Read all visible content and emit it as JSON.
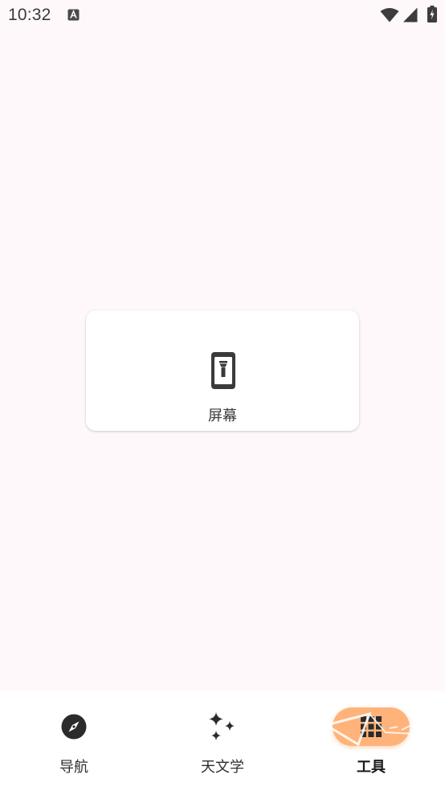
{
  "status_bar": {
    "time": "10:32",
    "notification_icon": "text-a-icon",
    "wifi_icon": "wifi-icon",
    "signal_icon": "cell-signal-icon",
    "battery_icon": "battery-charging-icon"
  },
  "tools": [
    {
      "label": "屏幕",
      "icon": "screen-flashlight-icon"
    }
  ],
  "bottom_nav": {
    "items": [
      {
        "label": "导航",
        "icon": "compass-icon",
        "active": false
      },
      {
        "label": "天文学",
        "icon": "sparkles-icon",
        "active": false
      },
      {
        "label": "工具",
        "icon": "grid-icon",
        "active": true
      }
    ]
  },
  "colors": {
    "background": "#fef8fb",
    "active_indicator": "#ffb37a",
    "icon": "#2b2b2b"
  }
}
